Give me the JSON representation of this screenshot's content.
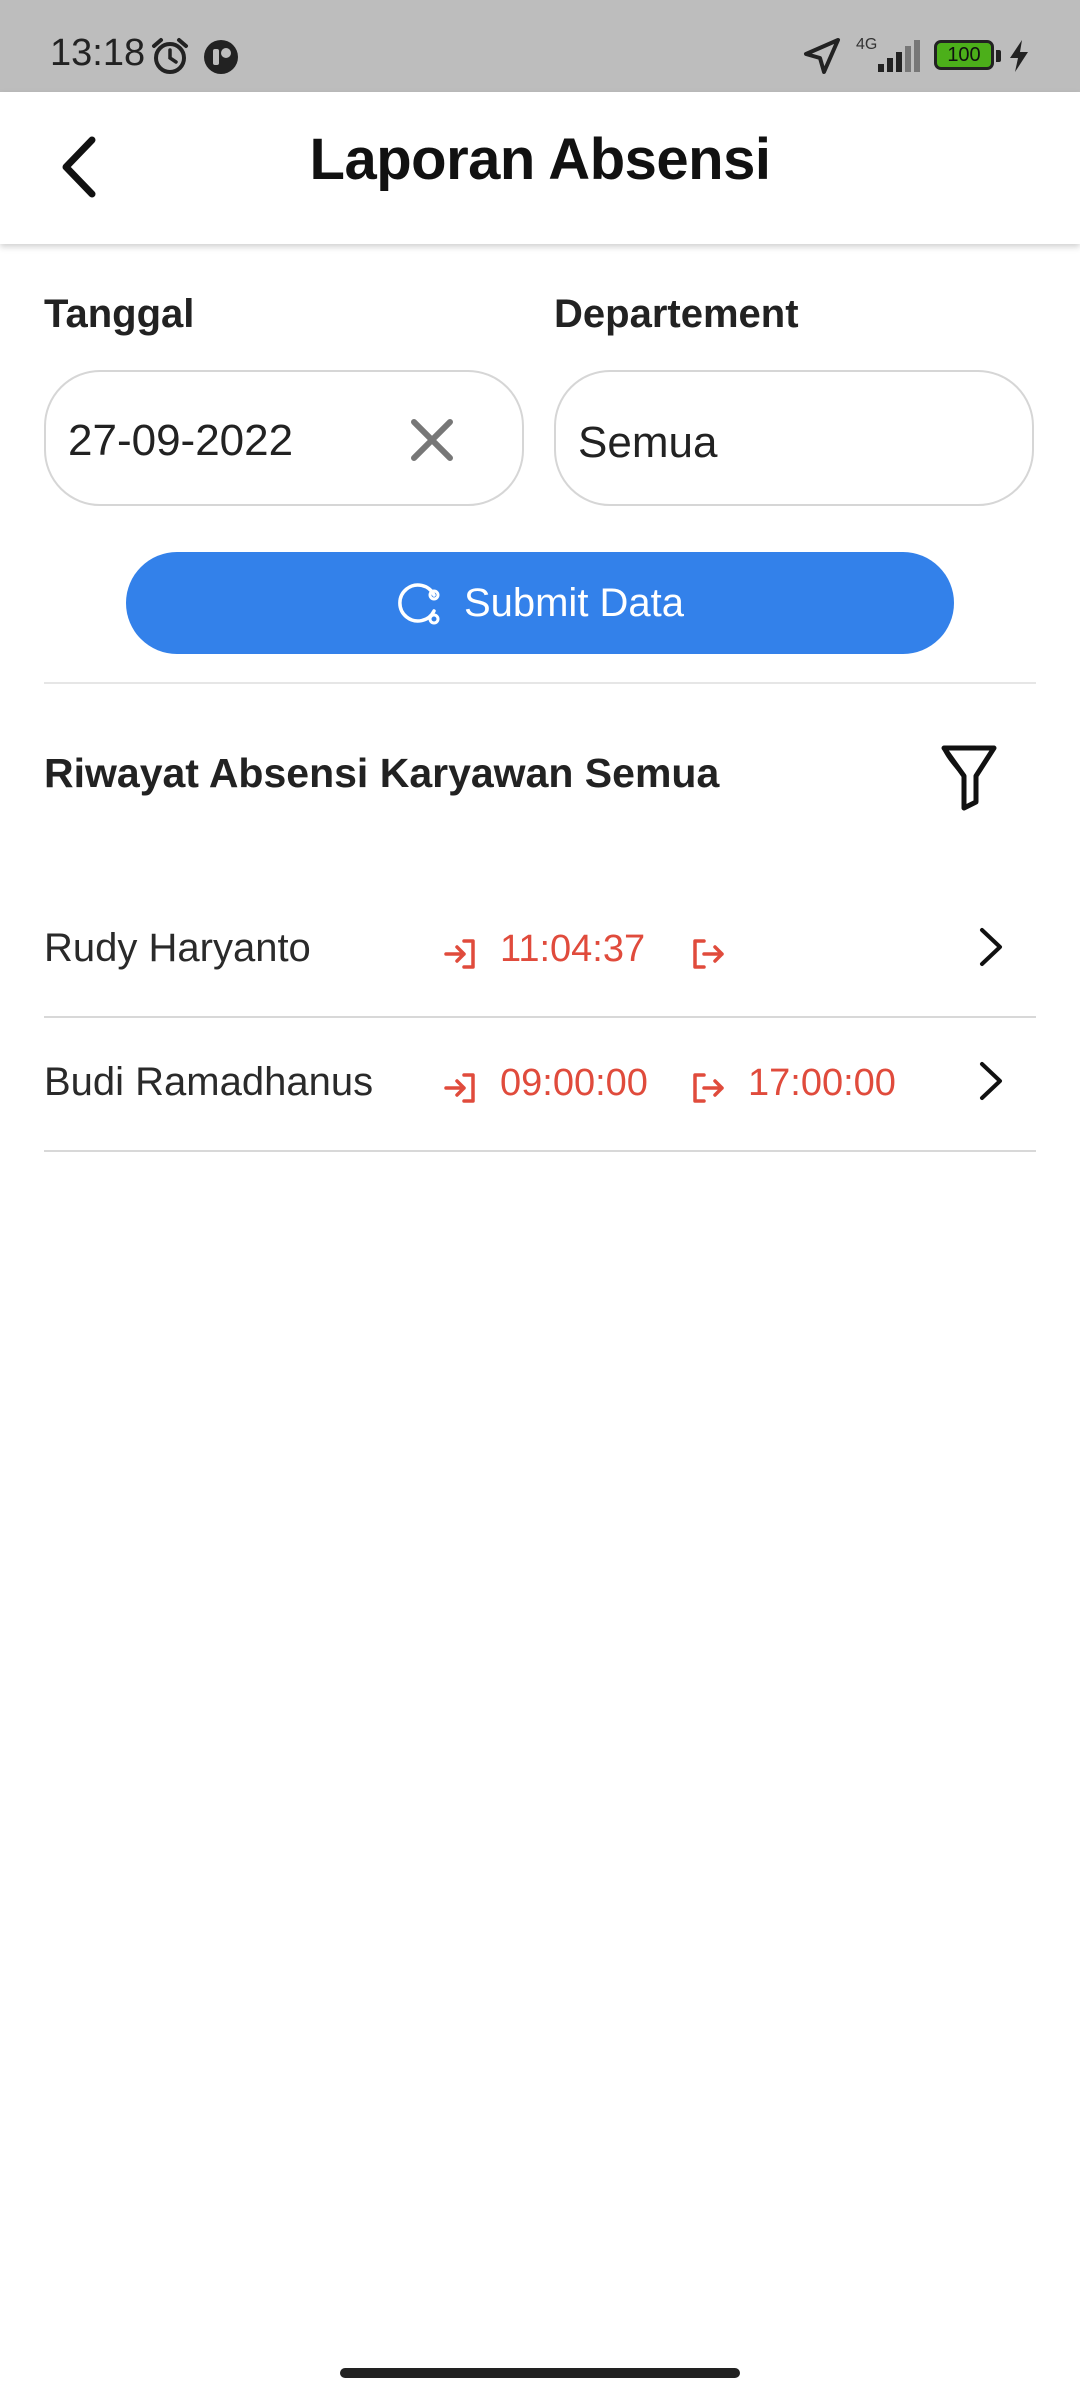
{
  "status_bar": {
    "time": "13:18",
    "network": "4G",
    "battery": "100",
    "icons": [
      "alarm-icon",
      "app-notification-icon",
      "location-arrow-icon",
      "signal-icon",
      "battery-icon",
      "charging-icon"
    ]
  },
  "header": {
    "title": "Laporan Absensi",
    "back_icon": "chevron-left-icon"
  },
  "form": {
    "date_label": "Tanggal",
    "date_value": "27-09-2022",
    "department_label": "Departement",
    "department_value": "Semua",
    "submit_label": "Submit Data"
  },
  "history": {
    "title": "Riwayat Absensi Karyawan Semua",
    "filter_icon": "filter-icon",
    "rows": [
      {
        "name": "Rudy Haryanto",
        "time_in": "11:04:37",
        "time_out": ""
      },
      {
        "name": "Budi Ramadhanus",
        "time_in": "09:00:00",
        "time_out": "17:00:00"
      }
    ]
  },
  "colors": {
    "status_bar": "#bdbdbd",
    "accent": "#3381ea",
    "time_text": "#e04b3c",
    "battery_fill": "#4caf1a"
  }
}
